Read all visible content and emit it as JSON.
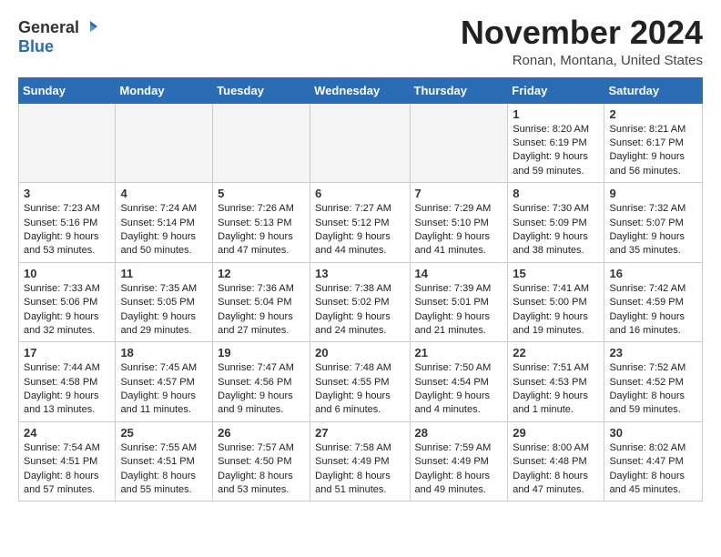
{
  "header": {
    "logo_general": "General",
    "logo_blue": "Blue",
    "month_title": "November 2024",
    "location": "Ronan, Montana, United States"
  },
  "days_of_week": [
    "Sunday",
    "Monday",
    "Tuesday",
    "Wednesday",
    "Thursday",
    "Friday",
    "Saturday"
  ],
  "weeks": [
    [
      {
        "day": "",
        "empty": true
      },
      {
        "day": "",
        "empty": true
      },
      {
        "day": "",
        "empty": true
      },
      {
        "day": "",
        "empty": true
      },
      {
        "day": "",
        "empty": true
      },
      {
        "day": "1",
        "sunrise": "8:20 AM",
        "sunset": "6:19 PM",
        "daylight": "9 hours and 59 minutes."
      },
      {
        "day": "2",
        "sunrise": "8:21 AM",
        "sunset": "6:17 PM",
        "daylight": "9 hours and 56 minutes."
      }
    ],
    [
      {
        "day": "3",
        "sunrise": "7:23 AM",
        "sunset": "5:16 PM",
        "daylight": "9 hours and 53 minutes."
      },
      {
        "day": "4",
        "sunrise": "7:24 AM",
        "sunset": "5:14 PM",
        "daylight": "9 hours and 50 minutes."
      },
      {
        "day": "5",
        "sunrise": "7:26 AM",
        "sunset": "5:13 PM",
        "daylight": "9 hours and 47 minutes."
      },
      {
        "day": "6",
        "sunrise": "7:27 AM",
        "sunset": "5:12 PM",
        "daylight": "9 hours and 44 minutes."
      },
      {
        "day": "7",
        "sunrise": "7:29 AM",
        "sunset": "5:10 PM",
        "daylight": "9 hours and 41 minutes."
      },
      {
        "day": "8",
        "sunrise": "7:30 AM",
        "sunset": "5:09 PM",
        "daylight": "9 hours and 38 minutes."
      },
      {
        "day": "9",
        "sunrise": "7:32 AM",
        "sunset": "5:07 PM",
        "daylight": "9 hours and 35 minutes."
      }
    ],
    [
      {
        "day": "10",
        "sunrise": "7:33 AM",
        "sunset": "5:06 PM",
        "daylight": "9 hours and 32 minutes."
      },
      {
        "day": "11",
        "sunrise": "7:35 AM",
        "sunset": "5:05 PM",
        "daylight": "9 hours and 29 minutes."
      },
      {
        "day": "12",
        "sunrise": "7:36 AM",
        "sunset": "5:04 PM",
        "daylight": "9 hours and 27 minutes."
      },
      {
        "day": "13",
        "sunrise": "7:38 AM",
        "sunset": "5:02 PM",
        "daylight": "9 hours and 24 minutes."
      },
      {
        "day": "14",
        "sunrise": "7:39 AM",
        "sunset": "5:01 PM",
        "daylight": "9 hours and 21 minutes."
      },
      {
        "day": "15",
        "sunrise": "7:41 AM",
        "sunset": "5:00 PM",
        "daylight": "9 hours and 19 minutes."
      },
      {
        "day": "16",
        "sunrise": "7:42 AM",
        "sunset": "4:59 PM",
        "daylight": "9 hours and 16 minutes."
      }
    ],
    [
      {
        "day": "17",
        "sunrise": "7:44 AM",
        "sunset": "4:58 PM",
        "daylight": "9 hours and 13 minutes."
      },
      {
        "day": "18",
        "sunrise": "7:45 AM",
        "sunset": "4:57 PM",
        "daylight": "9 hours and 11 minutes."
      },
      {
        "day": "19",
        "sunrise": "7:47 AM",
        "sunset": "4:56 PM",
        "daylight": "9 hours and 9 minutes."
      },
      {
        "day": "20",
        "sunrise": "7:48 AM",
        "sunset": "4:55 PM",
        "daylight": "9 hours and 6 minutes."
      },
      {
        "day": "21",
        "sunrise": "7:50 AM",
        "sunset": "4:54 PM",
        "daylight": "9 hours and 4 minutes."
      },
      {
        "day": "22",
        "sunrise": "7:51 AM",
        "sunset": "4:53 PM",
        "daylight": "9 hours and 1 minute."
      },
      {
        "day": "23",
        "sunrise": "7:52 AM",
        "sunset": "4:52 PM",
        "daylight": "8 hours and 59 minutes."
      }
    ],
    [
      {
        "day": "24",
        "sunrise": "7:54 AM",
        "sunset": "4:51 PM",
        "daylight": "8 hours and 57 minutes."
      },
      {
        "day": "25",
        "sunrise": "7:55 AM",
        "sunset": "4:51 PM",
        "daylight": "8 hours and 55 minutes."
      },
      {
        "day": "26",
        "sunrise": "7:57 AM",
        "sunset": "4:50 PM",
        "daylight": "8 hours and 53 minutes."
      },
      {
        "day": "27",
        "sunrise": "7:58 AM",
        "sunset": "4:49 PM",
        "daylight": "8 hours and 51 minutes."
      },
      {
        "day": "28",
        "sunrise": "7:59 AM",
        "sunset": "4:49 PM",
        "daylight": "8 hours and 49 minutes."
      },
      {
        "day": "29",
        "sunrise": "8:00 AM",
        "sunset": "4:48 PM",
        "daylight": "8 hours and 47 minutes."
      },
      {
        "day": "30",
        "sunrise": "8:02 AM",
        "sunset": "4:47 PM",
        "daylight": "8 hours and 45 minutes."
      }
    ]
  ]
}
